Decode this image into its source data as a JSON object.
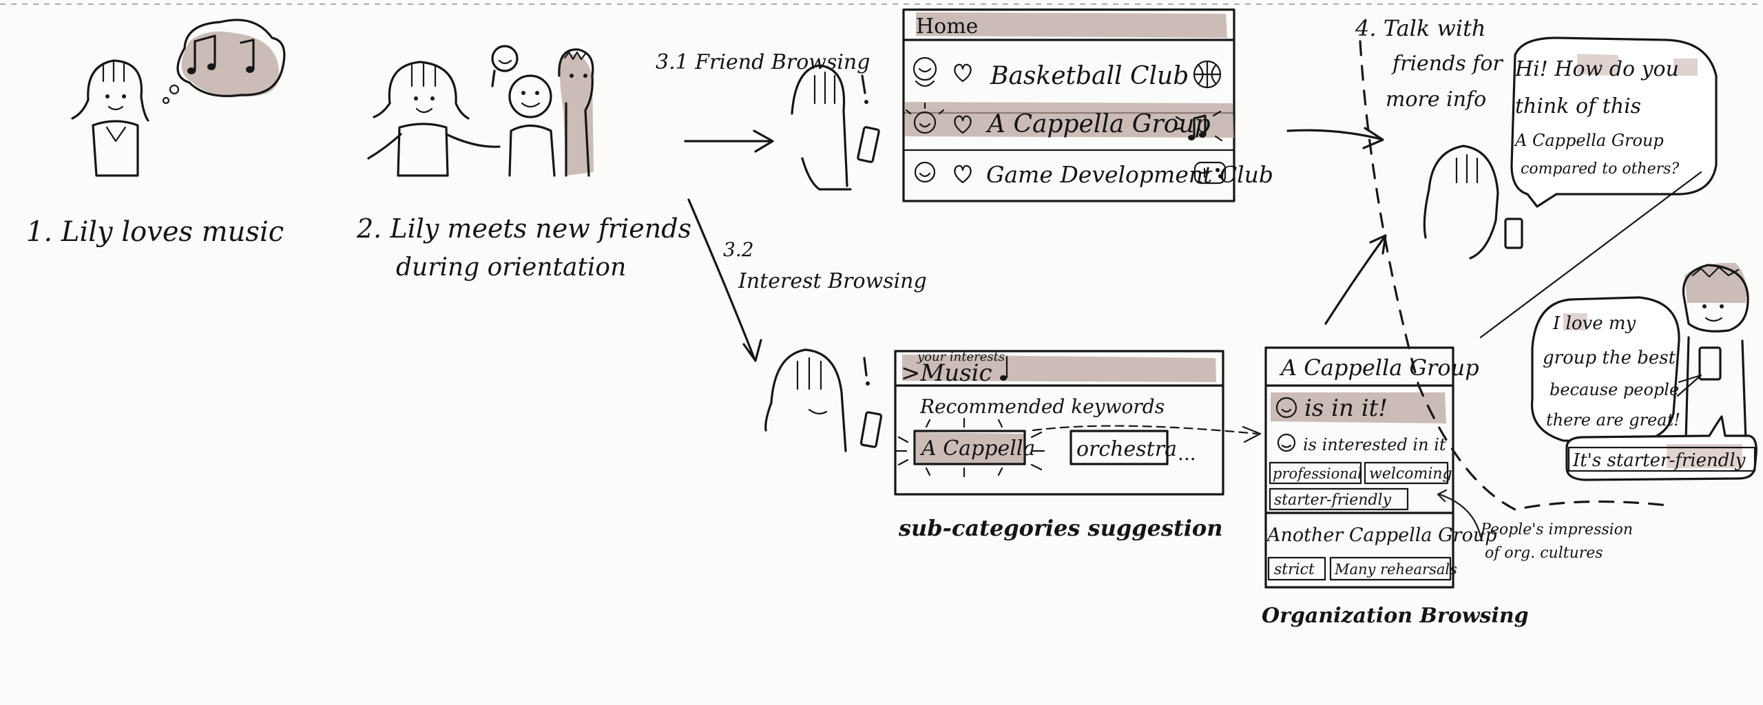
{
  "captions": {
    "step1": "1. Lily loves music",
    "step2_line1": "2. Lily meets new friends",
    "step2_line2": "during orientation",
    "step31": "3.1 Friend Browsing",
    "step32_num": "3.2",
    "step32_label": "Interest Browsing",
    "subcategories": "sub-categories suggestion",
    "org_browsing": "Organization Browsing",
    "step4_line1": "4. Talk with",
    "step4_line2": "friends for",
    "step4_line3": "more info",
    "impression_line1": "People's impression",
    "impression_line2": "of org. cultures"
  },
  "home_panel": {
    "title": "Home",
    "items": [
      {
        "label": "Basketball Club",
        "icon": "basketball-icon"
      },
      {
        "label": "A Cappella Group",
        "icon": "music-note-icon"
      },
      {
        "label": "Game Development Club",
        "icon": "gamepad-icon"
      }
    ]
  },
  "interest_panel": {
    "small_label": "your interests",
    "breadcrumb": ">Music",
    "recommended_title": "Recommended keywords",
    "chip1": "A Cappella",
    "chip2": "orchestra",
    "ellipsis": "..."
  },
  "org_panel": {
    "title": "A Cappella Group",
    "line1": "is in it!",
    "line2": "is interested in it",
    "tags": [
      "professional",
      "welcoming",
      "starter-friendly"
    ],
    "title2": "Another Cappella Group",
    "tags2": [
      "strict",
      "Many rehearsals"
    ]
  },
  "bubbles": {
    "lily_line1": "Hi! How do you",
    "lily_line2": "think of this",
    "lily_line3": "A Cappella Group",
    "lily_line4": "compared to others?",
    "friend_line1": "I love my",
    "friend_line2": "group the best",
    "friend_line3": "because people",
    "friend_line4": "there are great!",
    "friend_reply": "It's starter-friendly"
  },
  "colors": {
    "ink": "#161616",
    "wash": "#b8a49d",
    "paper": "#fbfbf9"
  }
}
